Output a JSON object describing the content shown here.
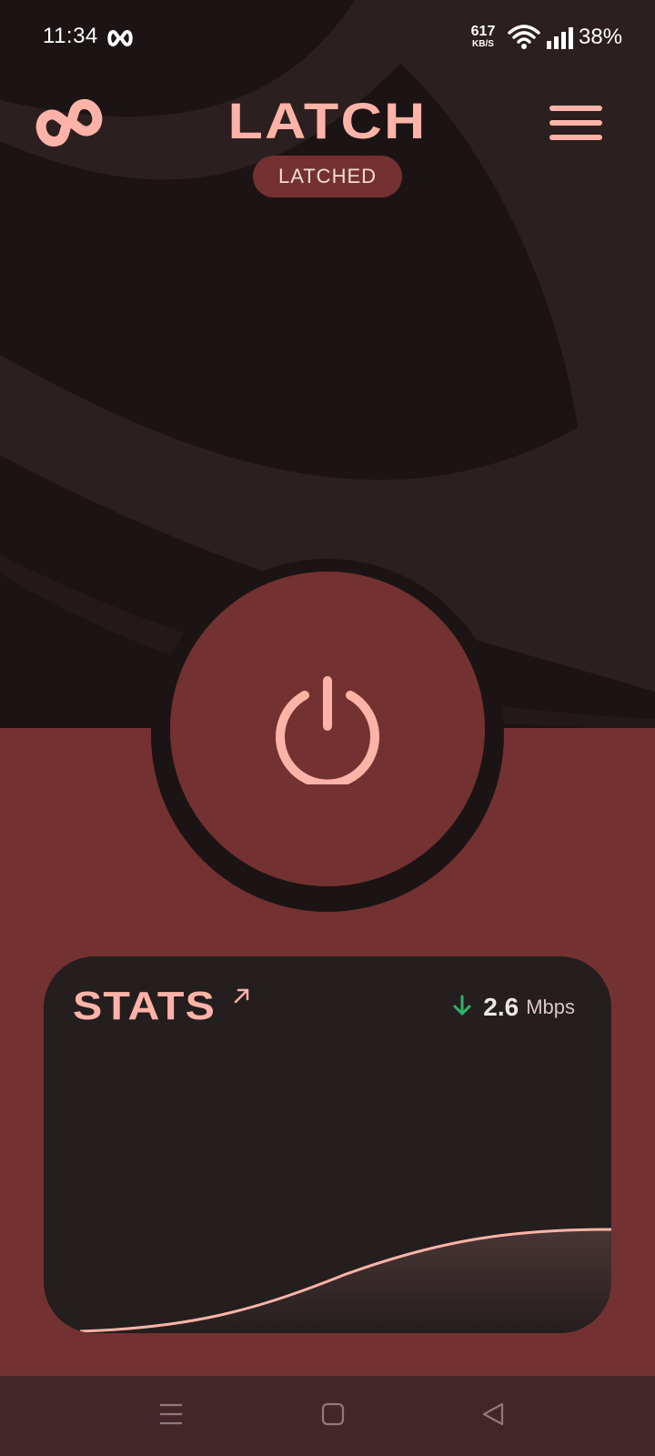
{
  "status_bar": {
    "time": "11:34",
    "net_speed_value": "617",
    "net_speed_unit": "KB/S",
    "battery": "38%",
    "icons": [
      "latch-app-icon",
      "wifi-icon",
      "signal-icon"
    ]
  },
  "header": {
    "title": "LATCH",
    "status_badge": "LATCHED",
    "logo_icon": "latch-link-logo",
    "menu_icon": "hamburger-menu-icon"
  },
  "power_button": {
    "icon": "power-icon",
    "state": "on"
  },
  "stats": {
    "title": "STATS",
    "link_icon": "arrow-up-right-icon",
    "direction_icon": "arrow-down-icon",
    "speed_value": "2.6",
    "speed_unit": "Mbps"
  },
  "nav_bar": {
    "buttons": [
      "recents-icon",
      "home-icon",
      "back-icon"
    ]
  },
  "colors": {
    "background_dark": "#1c1414",
    "background_swirl": "#2c1f1f",
    "accent_maroon": "#733231",
    "accent_pink": "#ffb3a8",
    "card_background": "#251e1e",
    "download_green": "#2fb36b",
    "nav_bar": "#42262a"
  }
}
